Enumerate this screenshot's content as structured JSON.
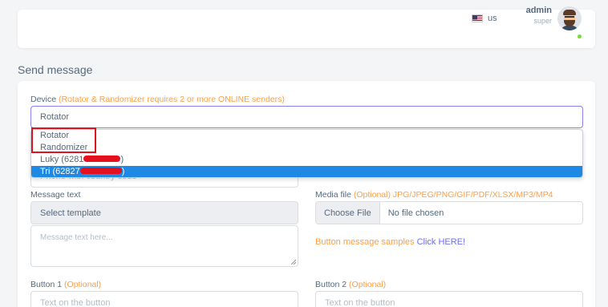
{
  "header": {
    "language": "us",
    "user_name": "admin",
    "user_role": "super"
  },
  "page_title": "Send message",
  "device": {
    "label": "Device",
    "note": "(Rotator & Randomizer requires 2 or more ONLINE senders)",
    "selected_value": "Rotator",
    "options": [
      {
        "prefix": "Rotator",
        "suffix": ""
      },
      {
        "prefix": "Randomizer",
        "suffix": ""
      },
      {
        "prefix": "Luky (6281",
        "suffix": ")"
      },
      {
        "prefix": "Tri (62827",
        "suffix": ")"
      }
    ]
  },
  "phone": {
    "placeholder": "Phone with country code"
  },
  "message_text": {
    "label": "Message text",
    "template_placeholder": "Select template",
    "textarea_placeholder": "Message text here..."
  },
  "media_file": {
    "label": "Media file",
    "note": "(Optional) JPG/JPEG/PNG/GIF/PDF/XLSX/MP3/MP4",
    "choose_label": "Choose File",
    "file_status": "No file chosen"
  },
  "button_samples": {
    "text": "Button message samples",
    "link": "Click HERE!"
  },
  "button1": {
    "label": "Button 1",
    "note": "(Optional)",
    "placeholder": "Text on the button"
  },
  "button2": {
    "label": "Button 2",
    "note": "(Optional)",
    "placeholder": "Text on the button"
  },
  "colors": {
    "accent": "#696cff",
    "optional": "#ff9f43",
    "selected_option": "#1e88e5",
    "highlight": "#e0121f",
    "online": "#71dd37"
  }
}
